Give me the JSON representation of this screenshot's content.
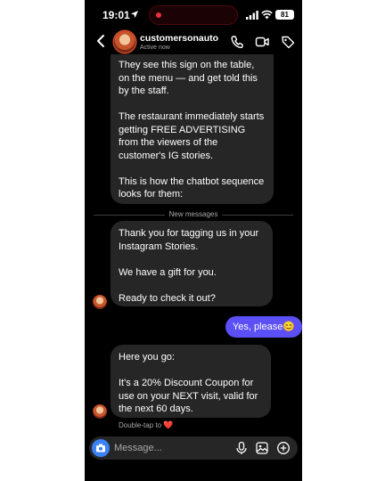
{
  "status_bar": {
    "time": "19:01",
    "battery": "81"
  },
  "header": {
    "contact_name": "customersonauto",
    "contact_status": "Active now",
    "icons": [
      "back-chevron-icon",
      "phone-icon",
      "video-camera-icon",
      "tag-icon"
    ]
  },
  "messages": {
    "previous_bot_text": "They see this sign on the table, on the menu — and get told this by the staff.\n\nThe restaurant immediately starts getting FREE ADVERTISING from the viewers of the customer's IG stories.\n\nThis is how the chatbot sequence looks for them:",
    "divider_label": "New messages",
    "bot_message_1": "Thank you for tagging us in your Instagram Stories.\n\nWe have a gift for you.\n\nReady to check it out?",
    "user_reply": "Yes, please😊",
    "bot_message_2": "Here you go:\n\nIt's a 20% Discount Coupon for use on your NEXT visit, valid for the next 60 days.",
    "reaction_hint": "Double-tap to",
    "reaction_emoji": "❤️"
  },
  "composer": {
    "placeholder": "Message...",
    "icons": [
      "camera-icon",
      "microphone-icon",
      "gallery-icon",
      "plus-circle-icon"
    ]
  },
  "colors": {
    "accent": "#5b4ff5",
    "bubble": "#262626",
    "camera_button": "#3b82f6",
    "record_dot": "#e9303d"
  }
}
